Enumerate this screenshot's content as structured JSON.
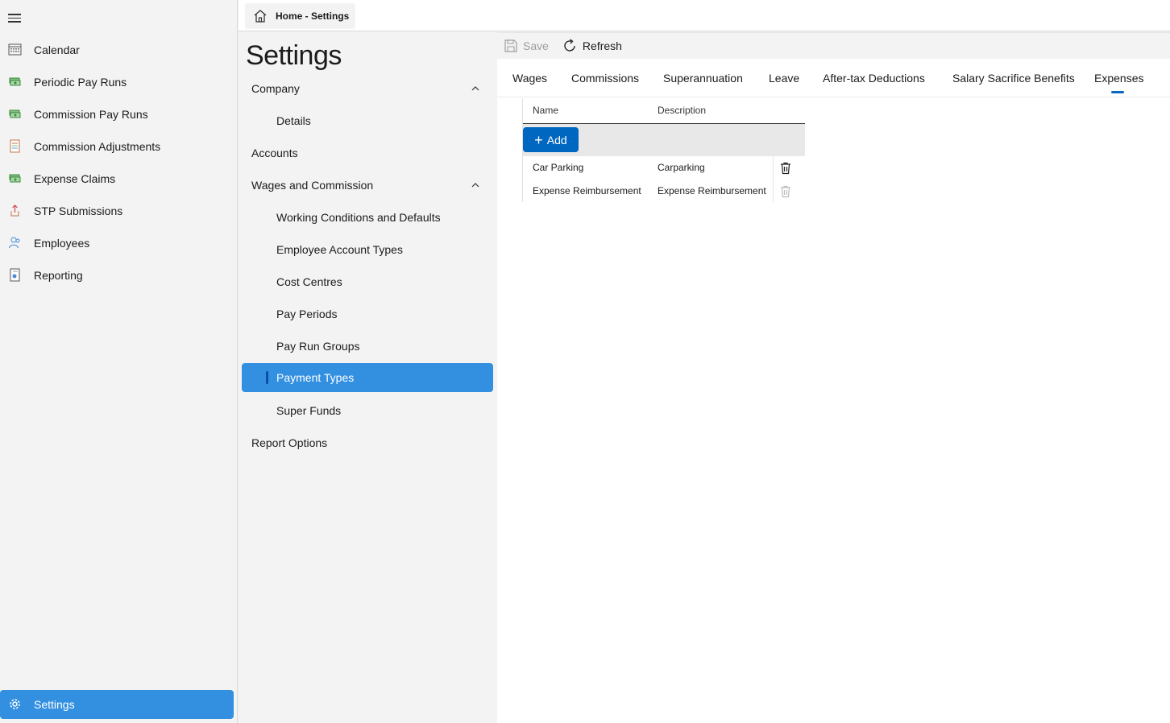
{
  "nav": {
    "items": [
      {
        "label": "Calendar",
        "icon": "calendar-icon"
      },
      {
        "label": "Periodic Pay Runs",
        "icon": "money-stack-icon"
      },
      {
        "label": "Commission Pay Runs",
        "icon": "money-stack-icon"
      },
      {
        "label": "Commission Adjustments",
        "icon": "adjustments-doc-icon"
      },
      {
        "label": "Expense Claims",
        "icon": "money-stack-icon"
      },
      {
        "label": "STP Submissions",
        "icon": "upload-doc-icon"
      },
      {
        "label": "Employees",
        "icon": "people-icon"
      },
      {
        "label": "Reporting",
        "icon": "report-icon"
      }
    ],
    "settings_label": "Settings"
  },
  "breadcrumb": {
    "text": "Home - Settings"
  },
  "settings": {
    "title": "Settings",
    "tree": [
      {
        "label": "Company",
        "level": 0,
        "expanded": true
      },
      {
        "label": "Details",
        "level": 1
      },
      {
        "label": "Accounts",
        "level": 0
      },
      {
        "label": "Wages and Commission",
        "level": 0,
        "expanded": true
      },
      {
        "label": "Working Conditions and Defaults",
        "level": 1
      },
      {
        "label": "Employee Account Types",
        "level": 1
      },
      {
        "label": "Cost Centres",
        "level": 1
      },
      {
        "label": "Pay Periods",
        "level": 1
      },
      {
        "label": "Pay Run Groups",
        "level": 1
      },
      {
        "label": "Payment Types",
        "level": 1,
        "selected": true
      },
      {
        "label": "Super Funds",
        "level": 1
      },
      {
        "label": "Report Options",
        "level": 0
      }
    ]
  },
  "toolbar": {
    "save_label": "Save",
    "refresh_label": "Refresh"
  },
  "tabs": [
    {
      "label": "Wages"
    },
    {
      "label": "Commissions"
    },
    {
      "label": "Superannuation"
    },
    {
      "label": "Leave"
    },
    {
      "label": "After-tax Deductions"
    },
    {
      "label": "Salary Sacrifice Benefits"
    },
    {
      "label": "Expenses",
      "active": true
    }
  ],
  "table": {
    "columns": [
      "Name",
      "Description"
    ],
    "add_label": "Add",
    "rows": [
      {
        "name": "Car Parking",
        "description": "Carparking"
      },
      {
        "name": "Expense Reimbursement",
        "description": "Expense Reimbursement"
      }
    ]
  },
  "colors": {
    "accent": "#3390e0",
    "primary_button": "#0067c0"
  }
}
